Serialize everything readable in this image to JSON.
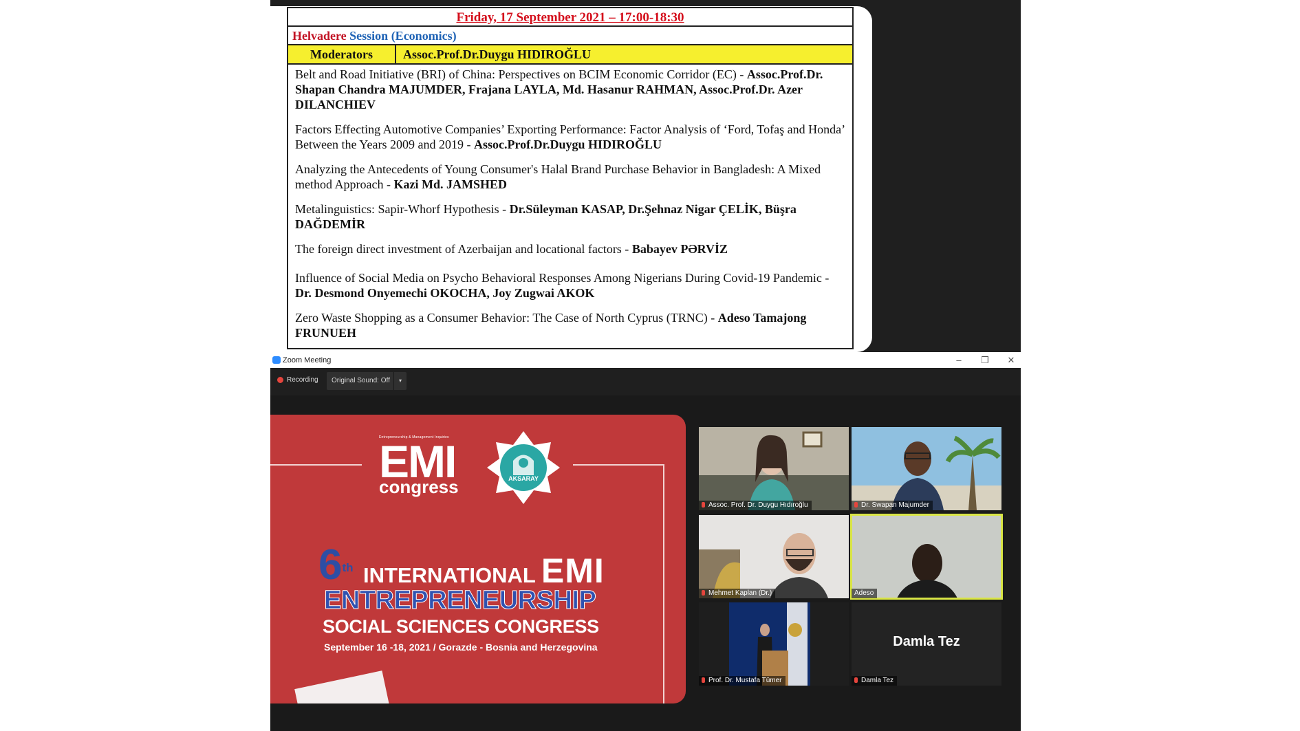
{
  "schedule": {
    "date_line": "Friday, 17 September 2021 – 17:00-18:30",
    "session_prefix": "Helvadere",
    "session_name": "Session",
    "session_topic": "(Economics)",
    "moderators_label": "Moderators",
    "moderator": "Assoc.Prof.Dr.Duygu HIDIROĞLU",
    "papers": [
      {
        "title": "Belt and Road Initiative (BRI) of China: Perspectives on BCIM Economic Corridor (EC) -",
        "authors": "Assoc.Prof.Dr. Shapan Chandra MAJUMDER, Frajana LAYLA, Md. Hasanur RAHMAN, Assoc.Prof.Dr. Azer DILANCHIEV"
      },
      {
        "title": "Factors Effecting Automotive Companies’ Exporting Performance: Factor Analysis of ‘Ford, Tofaş and Honda’ Between the Years 2009 and 2019 -",
        "authors": "Assoc.Prof.Dr.Duygu HIDIROĞLU"
      },
      {
        "title": "Analyzing the Antecedents of Young Consumer's Halal Brand Purchase Behavior in Bangladesh: A Mixed method Approach -",
        "authors": "Kazi Md. JAMSHED"
      },
      {
        "title": "Metalinguistics: Sapir-Whorf Hypothesis -",
        "authors": "Dr.Süleyman KASAP, Dr.Şehnaz Nigar ÇELİK, Büşra DAĞDEMİR"
      },
      {
        "title": "The foreign direct investment of Azerbaijan and locational factors -",
        "authors": "Babayev PƏRVİZ"
      },
      {
        "title": "Influence of Social Media on Psycho Behavioral Responses Among Nigerians During Covid-19 Pandemic -",
        "authors": "Dr. Desmond Onyemechi OKOCHA, Joy Zugwai AKOK"
      },
      {
        "title": "Zero Waste Shopping as a Consumer Behavior: The Case of North Cyprus (TRNC) -",
        "authors": "Adeso Tamajong FRUNUEH"
      }
    ]
  },
  "zoom": {
    "window_title": "Zoom Meeting",
    "window_buttons": [
      "–",
      "❐",
      "✕"
    ],
    "recording_label": "Recording",
    "original_sound": "Original Sound: Off",
    "sound_caret": "▾"
  },
  "banner": {
    "tagline": "Entrepreneurship & Management Inquiries",
    "logo_big": "EMI",
    "logo_small": "congress",
    "seal_text": "AKSARAY",
    "ordinal": "6",
    "ordinal_suffix": "th",
    "intl_word": "INTERNATIONAL",
    "intl_emi": "EMI",
    "line_entre": "ENTREPRENEURSHIP",
    "line_social": "SOCIAL SCIENCES CONGRESS",
    "dates": "September 16 -18, 2021 / Gorazde - Bosnia and Herzegovina"
  },
  "participants": [
    {
      "name": "Assoc. Prof. Dr. Duygu Hıdıroğlu"
    },
    {
      "name": "Dr. Swapan Majumder"
    },
    {
      "name": "Mehmet Kaplan (Dr.)"
    },
    {
      "name": "Adeso"
    },
    {
      "name": "Prof. Dr. Mustafa Tümer"
    },
    {
      "name": "Damla Tez",
      "display_name": "Damla Tez"
    }
  ],
  "colors": {
    "date_red": "#d40f1c",
    "session_blue": "#1f63b5",
    "moderator_yellow": "#f6ef2e",
    "banner_red": "#c0393a",
    "active_speaker": "#d9e545"
  }
}
